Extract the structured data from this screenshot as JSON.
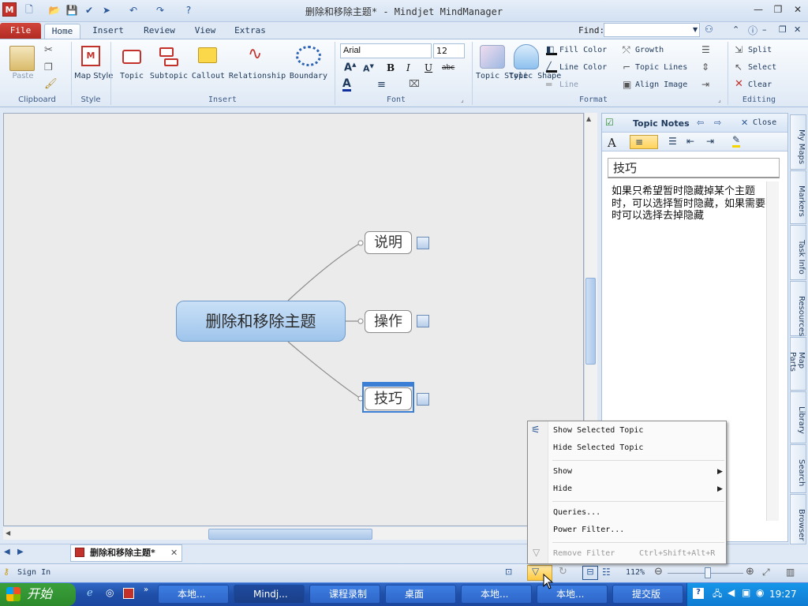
{
  "window": {
    "title": "删除和移除主题* - Mindjet MindManager"
  },
  "tabs": [
    "File",
    "Home",
    "Insert",
    "Review",
    "View",
    "Extras"
  ],
  "find": {
    "label": "Find:",
    "value": ""
  },
  "ribbon": {
    "clipboard": {
      "paste": "Paste",
      "label": "Clipboard"
    },
    "style": {
      "map_style": "Map Style",
      "label": "Style"
    },
    "insert": {
      "topic": "Topic",
      "subtopic": "Subtopic",
      "callout": "Callout",
      "relationship": "Relationship",
      "boundary": "Boundary",
      "label": "Insert"
    },
    "font": {
      "family": "Arial",
      "size": "12",
      "bold": "B",
      "italic": "I",
      "underline": "U",
      "strike": "abc",
      "label": "Font"
    },
    "format": {
      "topic_style": "Topic Style",
      "topic_shape": "Topic Shape",
      "fill_color": "Fill Color",
      "line_color": "Line Color",
      "line": "Line",
      "growth": "Growth",
      "topic_lines": "Topic Lines",
      "align_image": "Align Image",
      "label": "Format"
    },
    "editing": {
      "split": "Split",
      "select": "Select",
      "clear": "Clear",
      "label": "Editing"
    }
  },
  "map": {
    "central": "删除和移除主题",
    "topics": [
      "说明",
      "操作",
      "技巧"
    ]
  },
  "notes": {
    "title": "Topic Notes",
    "close": "Close",
    "topic": "技巧",
    "body": "如果只希望暂时隐藏掉某个主题时，可以选择暂时隐藏，如果需要时可以选择去掉隐藏"
  },
  "side_tabs": [
    "My Maps",
    "Markers",
    "Task Info",
    "Resources",
    "Map Parts",
    "Library",
    "Search",
    "Browser"
  ],
  "doc_tab": "删除和移除主题*",
  "status": {
    "sign_in": "Sign In",
    "zoom": "112%"
  },
  "menu": {
    "items": [
      {
        "label": "Show Selected Topic"
      },
      {
        "label": "Hide Selected Topic"
      },
      {
        "label": "Show"
      },
      {
        "label": "Hide"
      },
      {
        "label": "Queries..."
      },
      {
        "label": "Power Filter..."
      },
      {
        "label": "Remove Filter",
        "shortcut": "Ctrl+Shift+Alt+R"
      }
    ]
  },
  "taskbar": {
    "start": "开始",
    "tasks": [
      "本地...",
      "Mindj...",
      "课程录制",
      "桌面",
      "本地...",
      "本地...",
      "提交版"
    ],
    "time": "19:27"
  },
  "colors": {
    "accent": "#c2322b",
    "ribbon_bg": "#dfe9f5",
    "central_topic": "#a9cbee",
    "taskbar": "#245edb"
  }
}
